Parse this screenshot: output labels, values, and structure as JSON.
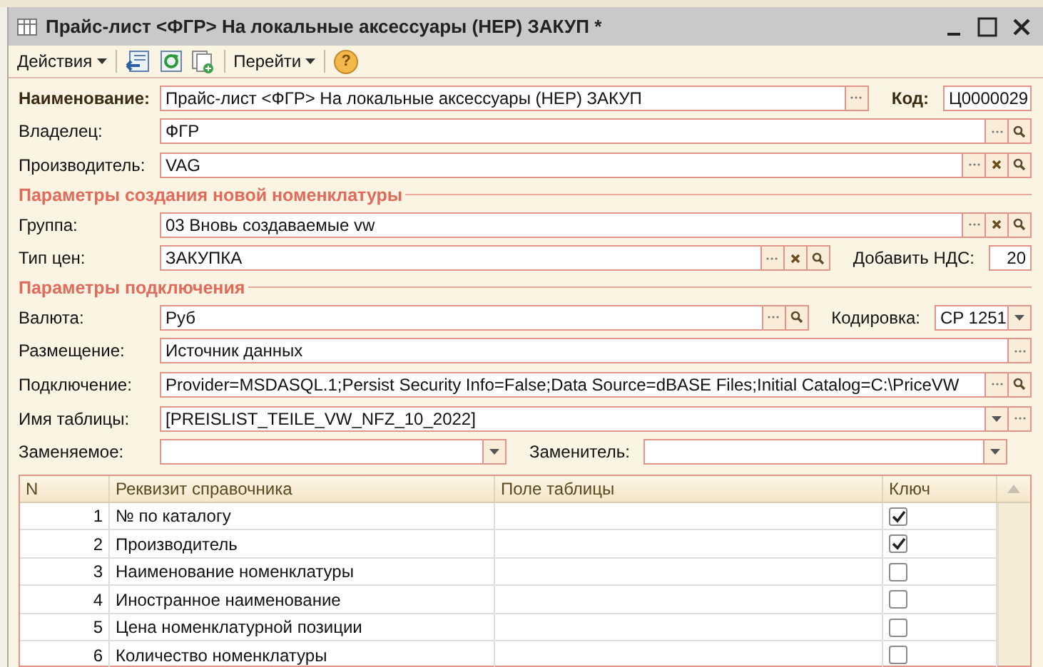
{
  "window": {
    "title": "Прайс-лист <ФГР> На локальные аксессуары (НЕР) ЗАКУП *"
  },
  "toolbar": [
    {
      "kind": "menu",
      "label": "Действия"
    },
    {
      "kind": "back"
    },
    {
      "kind": "refresh"
    },
    {
      "kind": "copy"
    },
    {
      "kind": "menu",
      "label": "Перейти"
    },
    {
      "kind": "help",
      "label": "?"
    }
  ],
  "form": [
    {
      "kind": "row",
      "fields": [
        {
          "label": "Наименование:",
          "bold": true,
          "value": "Прайс-лист <ФГР> На локальные аксессуары (НЕР) ЗАКУП",
          "buttons": [
            {
              "kind": "select"
            }
          ]
        },
        {
          "label": "Код:",
          "bold": true,
          "value": "Ц0000029"
        }
      ]
    },
    {
      "kind": "row",
      "fields": [
        {
          "label": "Владелец:",
          "bold": false,
          "value": "ФГР",
          "buttons": [
            {
              "kind": "select"
            },
            {
              "kind": "search"
            }
          ]
        }
      ]
    },
    {
      "kind": "row",
      "fields": [
        {
          "label": "Производитель:",
          "bold": false,
          "value": "VAG",
          "buttons": [
            {
              "kind": "select"
            },
            {
              "kind": "clear"
            },
            {
              "kind": "search"
            }
          ]
        }
      ]
    },
    {
      "kind": "section",
      "title": "Параметры создания новой номенклатуры"
    },
    {
      "kind": "row",
      "fields": [
        {
          "label": "Группа:",
          "bold": false,
          "value": "03 Вновь создаваемые vw",
          "buttons": [
            {
              "kind": "select"
            },
            {
              "kind": "clear"
            },
            {
              "kind": "search"
            }
          ]
        }
      ]
    },
    {
      "kind": "row",
      "fields": [
        {
          "label": "Тип цен:",
          "bold": false,
          "value": "ЗАКУПКА",
          "buttons": [
            {
              "kind": "select"
            },
            {
              "kind": "clear"
            },
            {
              "kind": "search"
            }
          ]
        },
        {
          "label": "Добавить НДС:",
          "bold": false,
          "value": "20"
        }
      ]
    },
    {
      "kind": "section",
      "title": "Параметры подключения"
    },
    {
      "kind": "row",
      "fields": [
        {
          "label": "Валюта:",
          "bold": false,
          "value": "Руб",
          "buttons": [
            {
              "kind": "select"
            },
            {
              "kind": "search"
            }
          ]
        },
        {
          "label": "Кодировка:",
          "bold": false,
          "value": "CP 1251",
          "buttons": [
            {
              "kind": "dropdown"
            }
          ]
        }
      ]
    },
    {
      "kind": "row",
      "fields": [
        {
          "label": "Размещение:",
          "bold": false,
          "value": "Источник данных",
          "buttons": [
            {
              "kind": "select"
            }
          ]
        }
      ]
    },
    {
      "kind": "row",
      "fields": [
        {
          "label": "Подключение:",
          "bold": false,
          "value": "Provider=MSDASQL.1;Persist Security Info=False;Data Source=dBASE Files;Initial Catalog=C:\\PriceVW",
          "buttons": [
            {
              "kind": "select"
            },
            {
              "kind": "search"
            }
          ]
        }
      ]
    },
    {
      "kind": "row",
      "fields": [
        {
          "label": "Имя таблицы:",
          "bold": false,
          "value": "[PREISLIST_TEILE_VW_NFZ_10_2022]",
          "buttons": [
            {
              "kind": "dropdown"
            },
            {
              "kind": "select"
            }
          ]
        }
      ]
    },
    {
      "kind": "row",
      "fields": [
        {
          "label": "Заменяемое:",
          "bold": false,
          "buttons": [
            {
              "kind": "dropdown"
            }
          ]
        },
        {
          "label": "Заменитель:",
          "bold": false,
          "buttons": [
            {
              "kind": "dropdown"
            }
          ]
        }
      ]
    }
  ],
  "table": {
    "columns": [
      "N",
      "Реквизит справочника",
      "Поле таблицы",
      "Ключ"
    ],
    "rows": [
      {
        "n": "1",
        "attribute": "№ по каталогу",
        "key": true
      },
      {
        "n": "2",
        "attribute": "Производитель",
        "key": true
      },
      {
        "n": "3",
        "attribute": "Наименование номенклатуры",
        "key": false
      },
      {
        "n": "4",
        "attribute": "Иностранное наименование",
        "key": false
      },
      {
        "n": "5",
        "attribute": "Цена номенклатурной позиции",
        "key": false
      },
      {
        "n": "6",
        "attribute": "Количество номенклатуры",
        "key": false
      }
    ]
  }
}
